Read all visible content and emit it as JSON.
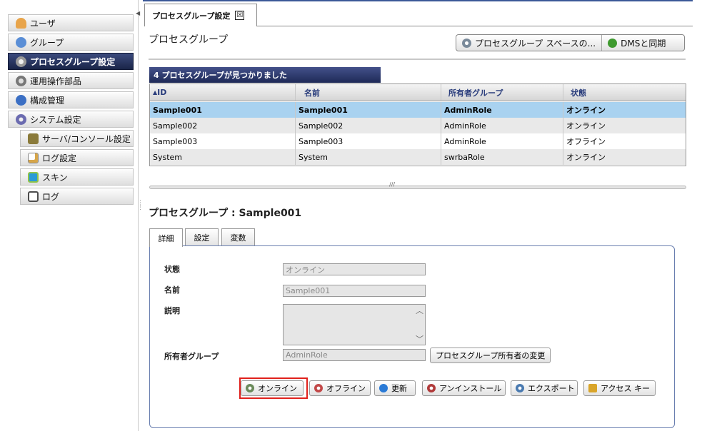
{
  "sidebar": {
    "items": [
      {
        "label": "ユーザ",
        "icon": "user-icon",
        "color": "#e8a44a"
      },
      {
        "label": "グループ",
        "icon": "group-icon",
        "color": "#5a8ed6"
      },
      {
        "label": "プロセスグループ設定",
        "icon": "gear-icon",
        "color": "#c8c8c8",
        "active": true
      },
      {
        "label": "運用操作部品",
        "icon": "gear-icon",
        "color": "#8a8a8a"
      },
      {
        "label": "構成管理",
        "icon": "config-icon",
        "color": "#3b6fc4"
      },
      {
        "label": "システム設定",
        "icon": "system-gear-icon",
        "color": "#6b6bb0"
      },
      {
        "label": "サーバ/コンソール設定",
        "icon": "server-icon",
        "color": "#8a7a3a"
      },
      {
        "label": "ログ設定",
        "icon": "log-settings-icon",
        "color": "#d7a64a"
      },
      {
        "label": "スキン",
        "icon": "skin-icon",
        "color": "#2a9ad6"
      },
      {
        "label": "ログ",
        "icon": "log-icon",
        "color": "#4d4d4d"
      }
    ]
  },
  "tabs": {
    "main": "プロセスグループ設定",
    "close": "☒"
  },
  "page": {
    "title": "プロセスグループ"
  },
  "header_buttons": {
    "process_space": "プロセスグループ スペースの...",
    "sync": "DMSと同期"
  },
  "results": {
    "banner": "4 プロセスグループが見つかりました",
    "columns": [
      "ID",
      "名前",
      "所有者グループ",
      "状態"
    ],
    "rows": [
      [
        "Sample001",
        "Sample001",
        "AdminRole",
        "オンライン"
      ],
      [
        "Sample002",
        "Sample002",
        "AdminRole",
        "オンライン"
      ],
      [
        "Sample003",
        "Sample003",
        "AdminRole",
        "オフライン"
      ],
      [
        "System",
        "System",
        "swrbaRole",
        "オンライン"
      ]
    ]
  },
  "detail": {
    "title": "プロセスグループ : Sample001",
    "tabs": [
      "詳細",
      "設定",
      "変数"
    ],
    "fields": {
      "status_label": "状態",
      "status_value": "オンライン",
      "name_label": "名前",
      "name_value": "Sample001",
      "desc_label": "説明",
      "desc_value": "",
      "owner_label": "所有者グループ",
      "owner_value": "AdminRole"
    },
    "owner_change_button": "プロセスグループ所有者の変更",
    "actions": [
      "オンライン",
      "オフライン",
      "更新",
      "アンインストール",
      "エクスポート",
      "アクセス キー"
    ]
  },
  "colors": {
    "selected_row": "#a9d2f0",
    "banner": "#1f2a57",
    "highlight": "#e0211c"
  }
}
